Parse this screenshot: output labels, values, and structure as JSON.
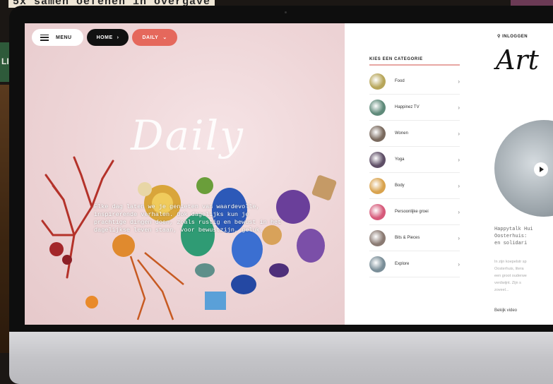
{
  "background": {
    "headline": "5x samen oefenen in overgave",
    "side_letters": "LI"
  },
  "topbar": {
    "menu_label": "MENU",
    "home_label": "HOME",
    "daily_label": "DAILY",
    "daily_color": "#e5685c"
  },
  "hero": {
    "title": "Daily",
    "text": "Elke dag laten we je genieten van waardevolle, inspirerende verhalen. Ook dagelijks kun je prachtige dingen doen, zoals rustig en bewust in het dagelijkse leven staan, voor bewustzijn, geluk."
  },
  "categories": {
    "heading": "KIES EEN CATEGORIE",
    "items": [
      {
        "label": "Food",
        "color": "#b7a65a"
      },
      {
        "label": "Happinez TV",
        "color": "#5f8a7a"
      },
      {
        "label": "Wonen",
        "color": "#7a6a5e"
      },
      {
        "label": "Yoga",
        "color": "#5e4e66"
      },
      {
        "label": "Body",
        "color": "#d9a34e"
      },
      {
        "label": "Persoonlijke groei",
        "color": "#d65a7a"
      },
      {
        "label": "Bits & Pieces",
        "color": "#8a7a72"
      },
      {
        "label": "Explore",
        "color": "#7a8e98"
      }
    ]
  },
  "account": {
    "login_label": "INLOGGEN",
    "logo_text": "Art"
  },
  "teaser": {
    "title_lines": [
      "Happytalk Hui",
      "Oosterhuis:",
      "en solidari"
    ],
    "body_lines": [
      "In zijn koepelstr sp",
      "Oosterhuis, litera",
      "een groot ouderwe",
      "verdwijnt. Zijn s",
      "zoveel..."
    ],
    "link_label": "Bekijk video"
  }
}
